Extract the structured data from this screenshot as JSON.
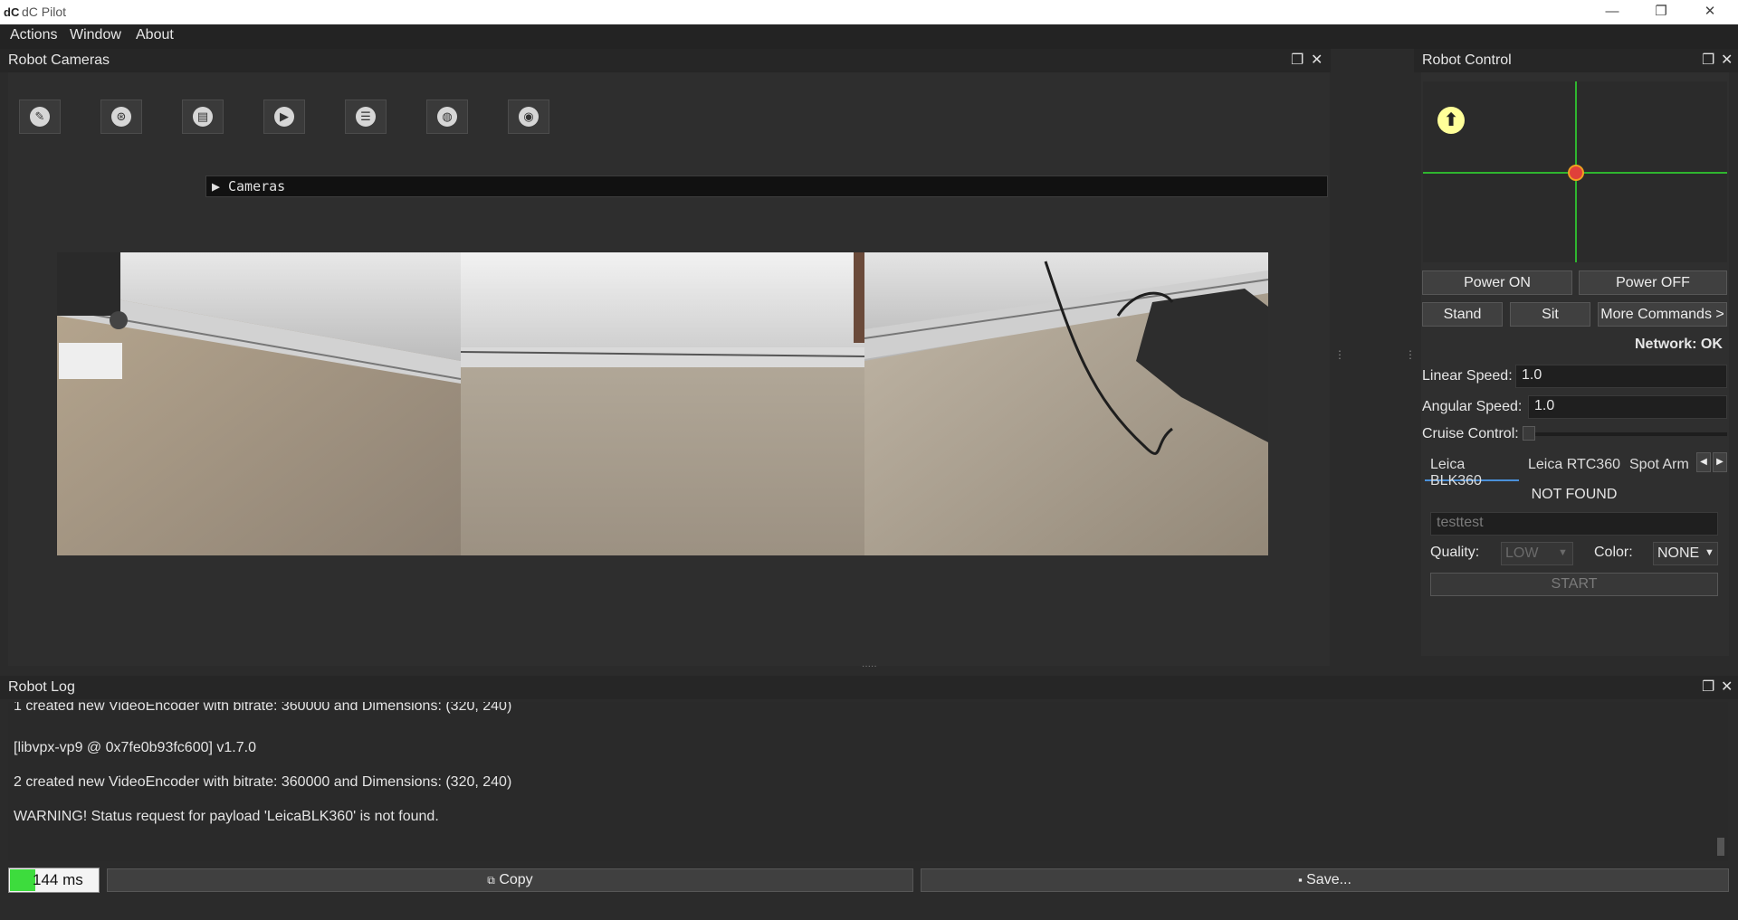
{
  "window": {
    "logo": "dC",
    "title": "dC Pilot",
    "minimize": "—",
    "maximize": "❐",
    "close": "✕"
  },
  "menu": [
    "Actions",
    "Window",
    "About"
  ],
  "cameras_panel": {
    "title": "Robot Cameras",
    "toolbar": [
      {
        "icon": "telescope-icon",
        "glyph": "✎"
      },
      {
        "icon": "lidar-icon",
        "glyph": "⊛"
      },
      {
        "icon": "scanner-icon",
        "glyph": "▤"
      },
      {
        "icon": "media-icon",
        "glyph": "▶"
      },
      {
        "icon": "list-icon",
        "glyph": "☰"
      },
      {
        "icon": "sphere-icon",
        "glyph": "◍"
      },
      {
        "icon": "camera-icon",
        "glyph": "◉"
      }
    ],
    "collapse_label": "Cameras"
  },
  "control_panel": {
    "title": "Robot Control",
    "power_on": "Power ON",
    "power_off": "Power OFF",
    "stand": "Stand",
    "sit": "Sit",
    "more_commands": "More Commands >",
    "network_status": "Network: OK",
    "linear_speed_label": "Linear Speed:",
    "linear_speed_value": "1.0",
    "angular_speed_label": "Angular Speed:",
    "angular_speed_value": "1.0",
    "cruise_control_label": "Cruise Control:",
    "tabs": [
      "Leica BLK360",
      "Leica RTC360",
      "Spot Arm"
    ],
    "active_tab": "Leica BLK360",
    "device_status": "NOT FOUND",
    "name_placeholder": "testtest",
    "quality_label": "Quality:",
    "quality_value": "LOW",
    "color_label": "Color:",
    "color_value": "NONE",
    "start_label": "START"
  },
  "log_panel": {
    "title": "Robot Log",
    "lines": [
      "1 created new VideoEncoder with bitrate: 360000 and Dimensions: (320, 240)",
      "[libvpx-vp9 @ 0x7fe0b93fc600] v1.7.0",
      "2 created new VideoEncoder with bitrate: 360000 and Dimensions: (320, 240)",
      "WARNING! Status request for payload 'LeicaBLK360' is not found."
    ],
    "latency": "144 ms",
    "copy_label": "Copy",
    "save_label": "Save..."
  },
  "colors": {
    "accent_green": "#3ddc3d",
    "joystick_dot": "#f0a020",
    "highlight_yellow": "#ffff99",
    "tab_underline": "#4a90d9"
  }
}
